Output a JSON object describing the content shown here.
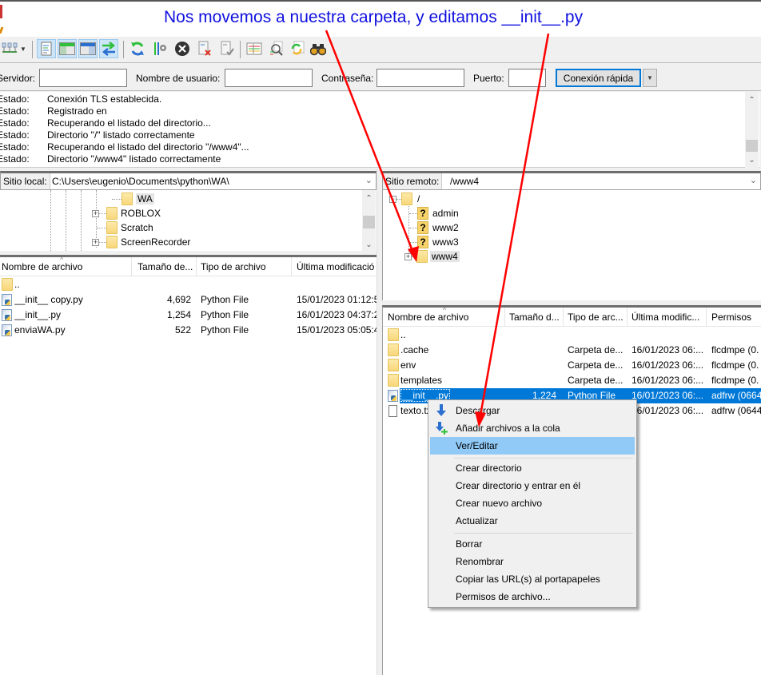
{
  "annotation": {
    "text": "Nos movemos a nuestra carpeta, y editamos __init__.py",
    "color": "#1010e0",
    "arrow_color": "#ff0000"
  },
  "toolbar": {
    "buttons": [
      {
        "name": "site-manager-icon"
      },
      {
        "name": "dropdown-arrow-icon"
      },
      {
        "name": "toggle-message-log-icon",
        "active": true
      },
      {
        "name": "toggle-local-tree-icon",
        "active": true
      },
      {
        "name": "toggle-remote-tree-icon",
        "active": true
      },
      {
        "name": "toggle-transfer-queue-icon",
        "active": true
      },
      {
        "name": "refresh-icon"
      },
      {
        "name": "process-queue-icon"
      },
      {
        "name": "cancel-icon"
      },
      {
        "name": "disconnect-icon"
      },
      {
        "name": "reconnect-icon"
      },
      {
        "name": "filter-icon"
      },
      {
        "name": "compare-dirs-icon"
      },
      {
        "name": "sync-browse-icon"
      },
      {
        "name": "search-files-icon"
      }
    ]
  },
  "quickconnect": {
    "host_label": "Servidor:",
    "host_value": "",
    "user_label": "Nombre de usuario:",
    "user_value": "",
    "password_label": "Contraseña:",
    "password_value": "",
    "port_label": "Puerto:",
    "port_value": "",
    "connect_label": "Conexión rápida"
  },
  "log": {
    "entries": [
      {
        "label": "Estado:",
        "message": "Conexión TLS establecida."
      },
      {
        "label": "Estado:",
        "message": "Registrado en"
      },
      {
        "label": "Estado:",
        "message": "Recuperando el listado del directorio..."
      },
      {
        "label": "Estado:",
        "message": "Directorio \"/\" listado correctamente"
      },
      {
        "label": "Estado:",
        "message": "Recuperando el listado del directorio \"/www4\"..."
      },
      {
        "label": "Estado:",
        "message": "Directorio \"/www4\" listado correctamente"
      }
    ]
  },
  "local": {
    "site_label": "Sitio local:",
    "path": "C:\\Users\\eugenio\\Documents\\python\\WA\\",
    "tree": [
      {
        "name": "WA",
        "expandable": false,
        "selected": true
      },
      {
        "name": "ROBLOX",
        "expandable": true
      },
      {
        "name": "Scratch",
        "expandable": false
      },
      {
        "name": "ScreenRecorder",
        "expandable": true
      }
    ],
    "columns": [
      "Nombre de archivo",
      "Tamaño de...",
      "Tipo de archivo",
      "Última modificació"
    ],
    "files": [
      {
        "name": "..",
        "size": "",
        "type": "",
        "modified": "",
        "icon": "folder"
      },
      {
        "name": "__init__ copy.py",
        "size": "4,692",
        "type": "Python File",
        "modified": "15/01/2023 01:12:5.",
        "icon": "python"
      },
      {
        "name": "__init__.py",
        "size": "1,254",
        "type": "Python File",
        "modified": "16/01/2023 04:37:2.",
        "icon": "python"
      },
      {
        "name": "enviaWA.py",
        "size": "522",
        "type": "Python File",
        "modified": "15/01/2023 05:05:4.",
        "icon": "python"
      }
    ]
  },
  "remote": {
    "site_label": "Sitio remoto:",
    "path": "/www4",
    "tree": [
      {
        "name": "/",
        "kind": "folder",
        "expandable": true
      },
      {
        "name": "admin",
        "kind": "unknown"
      },
      {
        "name": "www2",
        "kind": "unknown"
      },
      {
        "name": "www3",
        "kind": "unknown"
      },
      {
        "name": "www4",
        "kind": "folder",
        "expandable": true,
        "selected": true
      }
    ],
    "columns": [
      "Nombre de archivo",
      "Tamaño d...",
      "Tipo de arc...",
      "Última modific...",
      "Permisos"
    ],
    "files": [
      {
        "name": "..",
        "size": "",
        "type": "",
        "modified": "",
        "perms": "",
        "icon": "folder"
      },
      {
        "name": ".cache",
        "size": "",
        "type": "Carpeta de...",
        "modified": "16/01/2023 06:...",
        "perms": "flcdmpe (0.",
        "icon": "folder"
      },
      {
        "name": "env",
        "size": "",
        "type": "Carpeta de...",
        "modified": "16/01/2023 06:...",
        "perms": "flcdmpe (0.",
        "icon": "folder"
      },
      {
        "name": "templates",
        "size": "",
        "type": "Carpeta de...",
        "modified": "16/01/2023 06:...",
        "perms": "flcdmpe (0.",
        "icon": "folder"
      },
      {
        "name": "__init__.py",
        "size": "1,224",
        "type": "Python File",
        "modified": "16/01/2023 06:...",
        "perms": "adfrw (0664",
        "icon": "python",
        "selected": true
      },
      {
        "name": "texto.txt",
        "size": "",
        "type": "",
        "modified": "16/01/2023 06:...",
        "perms": "adfrw (0644",
        "icon": "text"
      }
    ]
  },
  "context_menu": {
    "items": [
      {
        "label": "Descargar",
        "icon": "download-icon"
      },
      {
        "label": "Añadir archivos a la cola",
        "icon": "add-to-queue-icon"
      },
      {
        "label": "Ver/Editar",
        "highlighted": true
      },
      {
        "separator": true
      },
      {
        "label": "Crear directorio"
      },
      {
        "label": "Crear directorio y entrar en él"
      },
      {
        "label": "Crear nuevo archivo"
      },
      {
        "label": "Actualizar"
      },
      {
        "separator": true
      },
      {
        "label": "Borrar"
      },
      {
        "label": "Renombrar"
      },
      {
        "label": "Copiar las URL(s) al portapapeles"
      },
      {
        "label": "Permisos de archivo..."
      }
    ]
  }
}
